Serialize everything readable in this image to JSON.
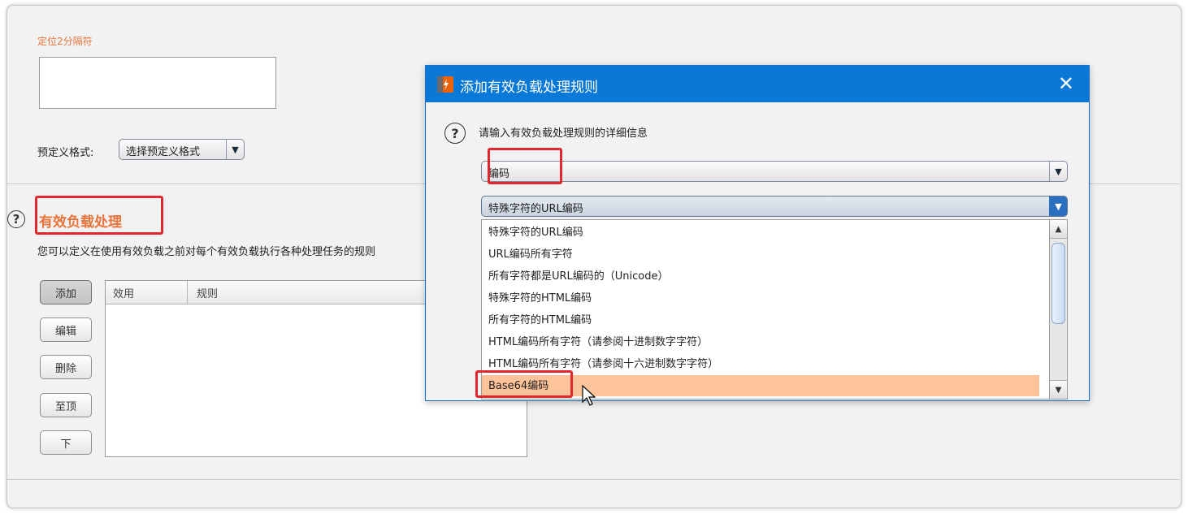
{
  "background_panel": {
    "delimiter2_label": "定位2分隔符",
    "predefined_format_label": "预定义格式:",
    "predefined_format_value": "选择预定义格式",
    "section_title": "有效负载处理",
    "section_desc": "您可以定义在使用有效负载之前对每个有效负载执行各种处理任务的规则",
    "buttons": [
      "添加",
      "编辑",
      "删除",
      "至顶",
      "下"
    ],
    "table_headers": [
      "效用",
      "规则"
    ]
  },
  "dialog": {
    "title": "添加有效负载处理规则",
    "prompt": "请输入有效负载处理规则的详细信息",
    "rule_type_value": "编码",
    "encoding_value": "特殊字符的URL编码",
    "options": [
      "特殊字符的URL编码",
      "URL编码所有字符",
      "所有字符都是URL编码的（Unicode）",
      "特殊字符的HTML编码",
      "所有字符的HTML编码",
      "HTML编码所有字符（请参阅十进制数字字符）",
      "HTML编码所有字符（请参阅十六进制数字字符）",
      "Base64编码"
    ],
    "selected_option": "Base64编码"
  },
  "colors": {
    "accent_orange": "#e8743b",
    "titlebar_blue": "#0a78d7",
    "highlight_red": "#e0262e",
    "selected_row": "#ffc39a"
  },
  "icons": {
    "help": "help-icon",
    "close": "close-icon",
    "app": "burp-app-icon",
    "dropdown": "chevron-down-icon"
  }
}
